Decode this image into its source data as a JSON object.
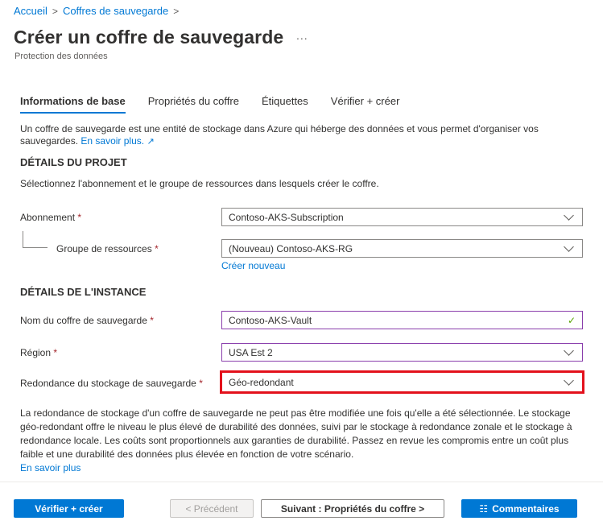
{
  "breadcrumb": {
    "items": [
      "Accueil",
      "Coffres de sauvegarde"
    ],
    "separator": ">"
  },
  "header": {
    "title": "Créer un coffre de sauvegarde",
    "more": "...",
    "subtitle": "Protection des données"
  },
  "tabs": [
    {
      "label": "Informations de base",
      "active": true
    },
    {
      "label": "Propriétés du coffre",
      "active": false
    },
    {
      "label": "Étiquettes",
      "active": false
    },
    {
      "label": "Vérifier + créer",
      "active": false
    }
  ],
  "intro": {
    "text": "Un coffre de sauvegarde est une entité de stockage dans Azure qui héberge des données et vous permet d'organiser vos sauvegardes.",
    "link": "En savoir plus."
  },
  "project": {
    "heading": "DÉTAILS DU PROJET",
    "description": "Sélectionnez l'abonnement et le groupe de ressources dans lesquels créer le coffre.",
    "subscription": {
      "label": "Abonnement",
      "required": "*",
      "value": "Contoso-AKS-Subscription"
    },
    "resource_group": {
      "label": "Groupe de ressources",
      "required": "*",
      "value": "(Nouveau) Contoso-AKS-RG",
      "create_new": "Créer nouveau"
    }
  },
  "instance": {
    "heading": "DÉTAILS DE L'INSTANCE",
    "vault_name": {
      "label": "Nom du coffre de sauvegarde",
      "required": "*",
      "value": "Contoso-AKS-Vault",
      "valid_icon": "✓"
    },
    "region": {
      "label": "Région",
      "required": "*",
      "value": "USA Est 2"
    },
    "redundancy": {
      "label": "Redondance du stockage de sauvegarde",
      "required": "*",
      "value": "Géo-redondant"
    }
  },
  "note": {
    "text": "La redondance de stockage d'un coffre de sauvegarde ne peut pas être modifiée une fois qu'elle a été sélectionnée. Le stockage géo-redondant offre le niveau le plus élevé de durabilité des données, suivi par le stockage à redondance zonale et le stockage à redondance locale. Les coûts sont proportionnels aux garanties de durabilité. Passez en revue les compromis entre un coût plus faible et une durabilité des données plus élevée en fonction de votre scénario.",
    "link": "En savoir plus"
  },
  "footer": {
    "review_create": "Vérifier + créer",
    "previous": "< Précédent",
    "next": "Suivant : Propriétés du coffre >",
    "feedback": "Commentaires"
  },
  "colors": {
    "accent": "#0078d4",
    "highlight": "#e3111c",
    "required": "#a4262c",
    "valid": "#57a300"
  }
}
